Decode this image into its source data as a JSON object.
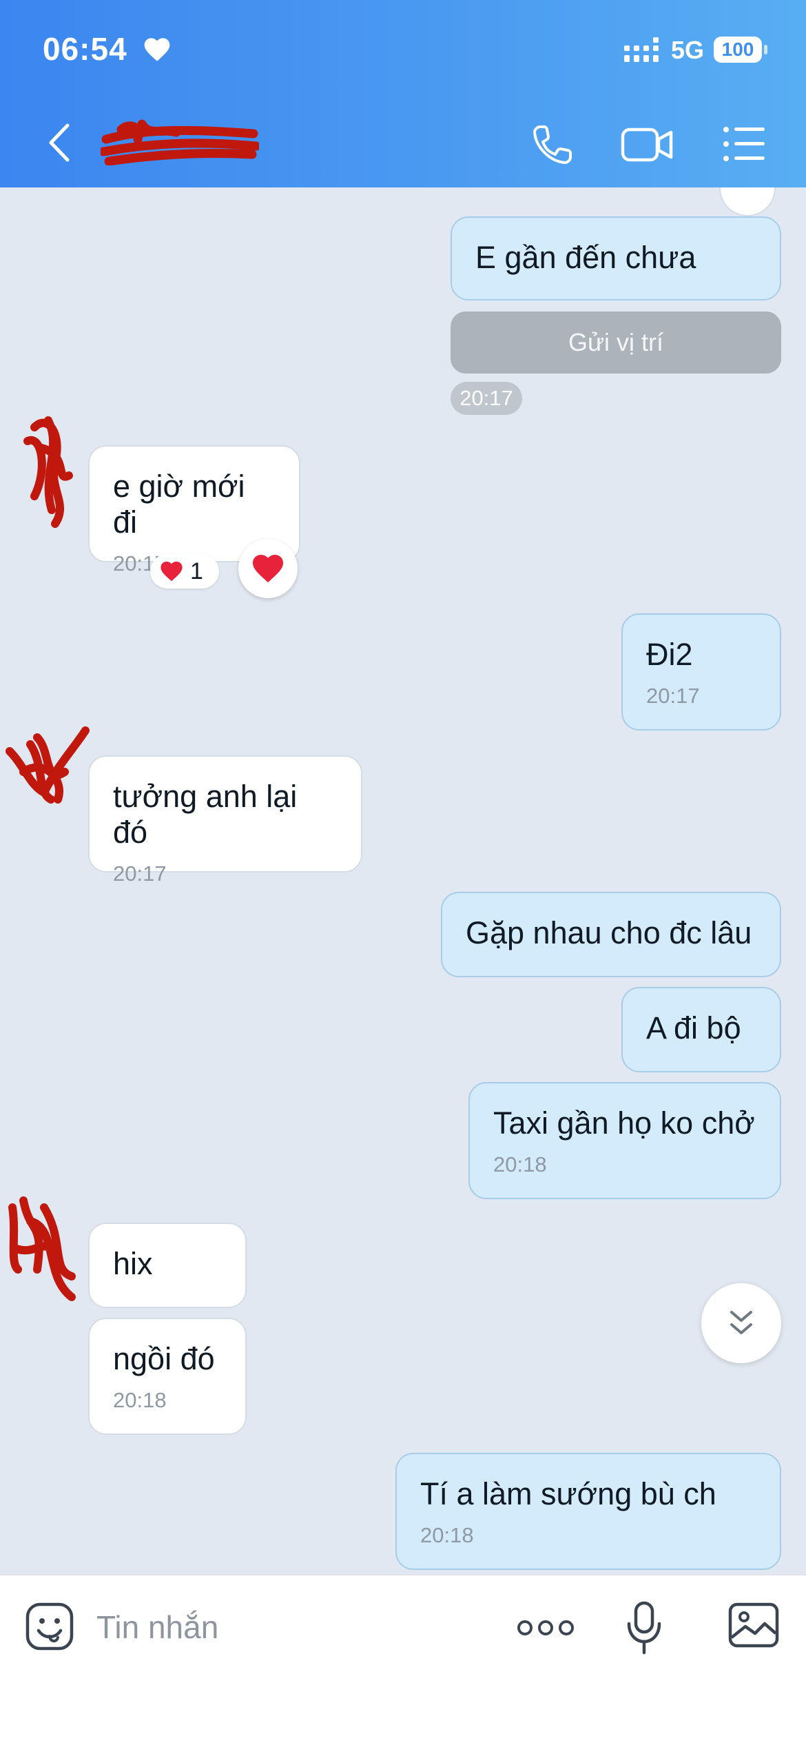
{
  "status_bar": {
    "time": "06:54",
    "network": "5G",
    "battery": "100"
  },
  "header": {
    "contact_name": ""
  },
  "messages": [
    {
      "sender": "me",
      "text": "E gần đến chưa"
    },
    {
      "sender": "me",
      "type": "location",
      "text": "Gửi vị trí"
    },
    {
      "type": "timestamp",
      "text": "20:17"
    },
    {
      "sender": "other",
      "text": "e giờ mới đi",
      "time": "20:17",
      "reactions": {
        "emoji": "heart",
        "count": "1"
      }
    },
    {
      "sender": "me",
      "text": "Đi2",
      "time": "20:17"
    },
    {
      "sender": "other",
      "text": "tưởng anh lại đó",
      "time": "20:17"
    },
    {
      "sender": "me",
      "text": "Gặp nhau cho đc lâu"
    },
    {
      "sender": "me",
      "text": "A đi bộ"
    },
    {
      "sender": "me",
      "text": "Taxi gần họ ko chở",
      "time": "20:18"
    },
    {
      "sender": "other",
      "text": "hix"
    },
    {
      "sender": "other",
      "text": "ngồi đó",
      "time": "20:18"
    },
    {
      "sender": "me",
      "text": "Tí a làm sướng bù ch",
      "time": "20:18"
    }
  ],
  "input": {
    "placeholder": "Tin nhắn"
  },
  "icons": {
    "back": "chevron-left-icon",
    "call": "phone-icon",
    "video": "video-camera-icon",
    "menu": "list-icon",
    "emoji": "smiley-sticker-icon",
    "more": "more-dots-icon",
    "mic": "microphone-icon",
    "image": "image-icon",
    "scroll": "double-chevron-down-icon",
    "reaction": "heart-icon"
  },
  "colors": {
    "header_start": "#3b86f0",
    "header_end": "#58aef3",
    "my_bubble": "#d4ebfc",
    "other_bubble": "#ffffff",
    "chat_bg": "#e2e8f1",
    "heart": "#e8223a",
    "redaction": "#c0180c"
  }
}
